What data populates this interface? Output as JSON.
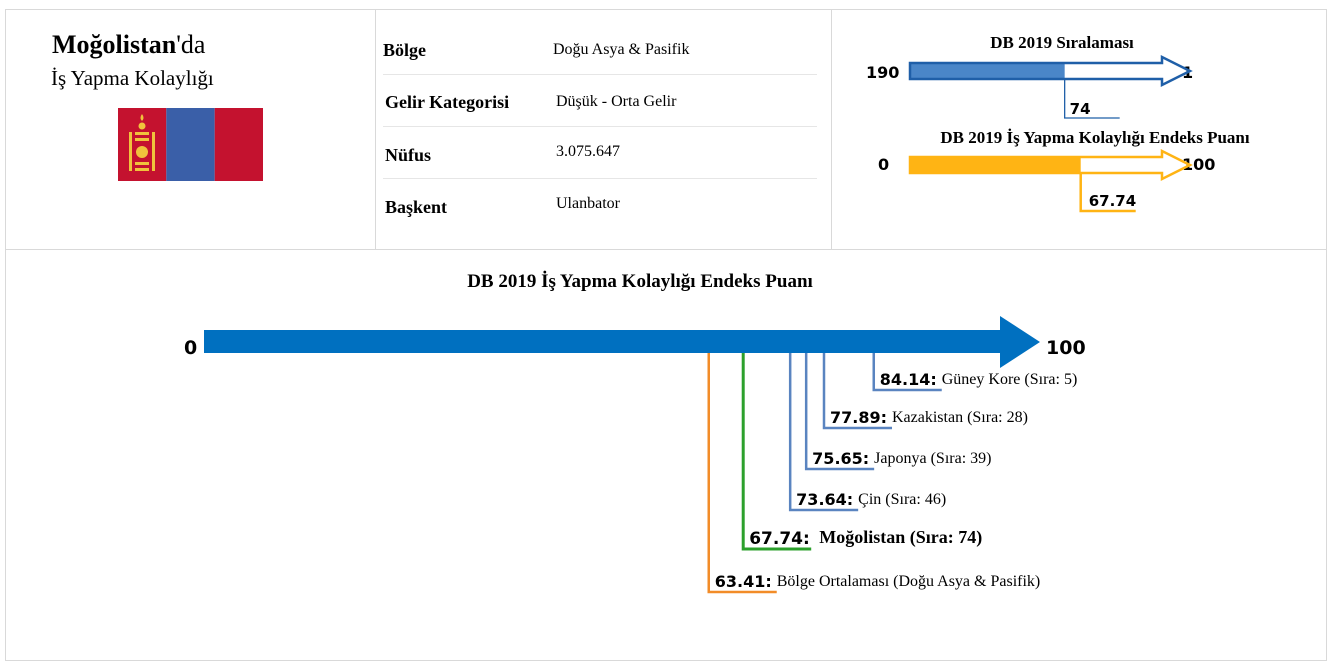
{
  "header": {
    "country_bold": "Moğolistan",
    "country_suffix": "'da",
    "subtitle": "İş Yapma Kolaylığı"
  },
  "flag": {
    "colors": [
      "#c4122f",
      "#3a5fa8",
      "#c4122f"
    ],
    "emblem_color": "#f0c33c"
  },
  "info": [
    {
      "label": "Bölge",
      "value": "Doğu Asya & Pasifik"
    },
    {
      "label": "Gelir Kategorisi",
      "value": "Düşük - Orta Gelir"
    },
    {
      "label": "Nüfus",
      "value": "3.075.647"
    },
    {
      "label": "Başkent",
      "value": "Ulanbator"
    }
  ],
  "colors": {
    "rank_blue": "#4a86c8",
    "rank_arrow": "#1f5fa8",
    "score_gold": "#ffb414",
    "main_blue": "#0070c0",
    "highlight_green": "#2ca02c",
    "region_orange": "#f28c28",
    "peer_blue": "#5a84c0"
  },
  "chart_data": [
    {
      "type": "bar",
      "title": "DB 2019 Sıralaması",
      "axis": {
        "start_label": "190",
        "end_label": "1",
        "start": 190,
        "end": 1
      },
      "value": 74,
      "value_label": "74"
    },
    {
      "type": "bar",
      "title": "DB 2019 İş Yapma Kolaylığı Endeks Puanı",
      "axis": {
        "start_label": "0",
        "end_label": "100",
        "start": 0,
        "end": 100
      },
      "value": 67.74,
      "value_label": "67.74"
    },
    {
      "type": "scatter",
      "title": "DB 2019 İş Yapma Kolaylığı Endeks Puanı",
      "axis": {
        "start_label": "0",
        "end_label": "100",
        "start": 0,
        "end": 100
      },
      "points": [
        {
          "value": 84.14,
          "value_label": "84.14:",
          "label": "Güney Kore (Sıra: 5)",
          "role": "peer"
        },
        {
          "value": 77.89,
          "value_label": "77.89:",
          "label": "Kazakistan (Sıra: 28)",
          "role": "peer"
        },
        {
          "value": 75.65,
          "value_label": "75.65:",
          "label": "Japonya (Sıra: 39)",
          "role": "peer"
        },
        {
          "value": 73.64,
          "value_label": "73.64:",
          "label": "Çin (Sıra: 46)",
          "role": "peer"
        },
        {
          "value": 67.74,
          "value_label": "67.74:",
          "label": "Moğolistan (Sıra: 74)",
          "role": "highlight"
        },
        {
          "value": 63.41,
          "value_label": "63.41:",
          "label": "Bölge Ortalaması (Doğu Asya & Pasifik)",
          "role": "region"
        }
      ]
    }
  ]
}
